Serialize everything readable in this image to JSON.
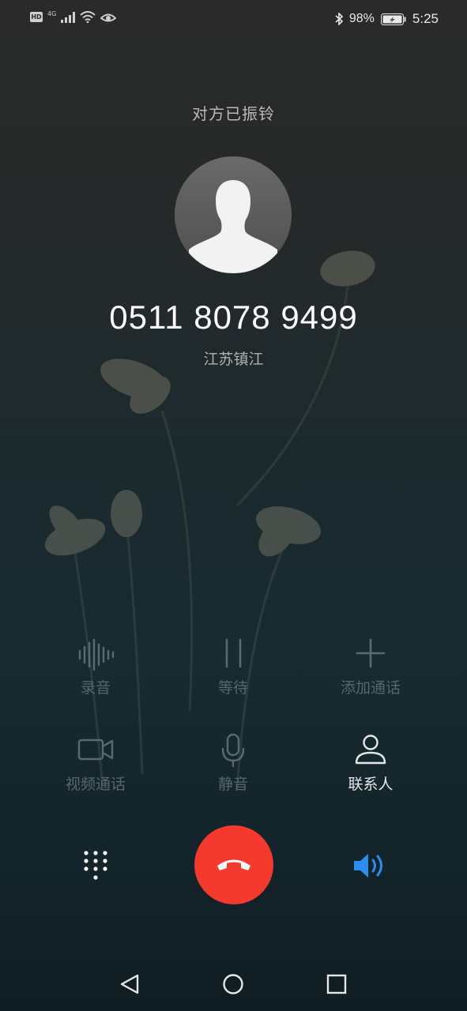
{
  "status_bar": {
    "hd_badge": "HD",
    "network": "4G",
    "battery": "98%",
    "time": "5:25"
  },
  "call": {
    "status": "对方已振铃",
    "number": "0511 8078 9499",
    "location": "江苏镇江"
  },
  "actions": {
    "record": "录音",
    "hold": "等待",
    "add_call": "添加通话",
    "video_call": "视频通话",
    "mute": "静音",
    "contacts": "联系人"
  },
  "colors": {
    "end_call": "#f4392f",
    "speaker_active": "#2c8df0"
  },
  "icons": {
    "dialpad": "dialpad-icon",
    "end_call": "phone-hangup-icon",
    "speaker": "speaker-icon",
    "back": "back-triangle-icon",
    "home": "home-circle-icon",
    "recents": "recents-square-icon"
  }
}
